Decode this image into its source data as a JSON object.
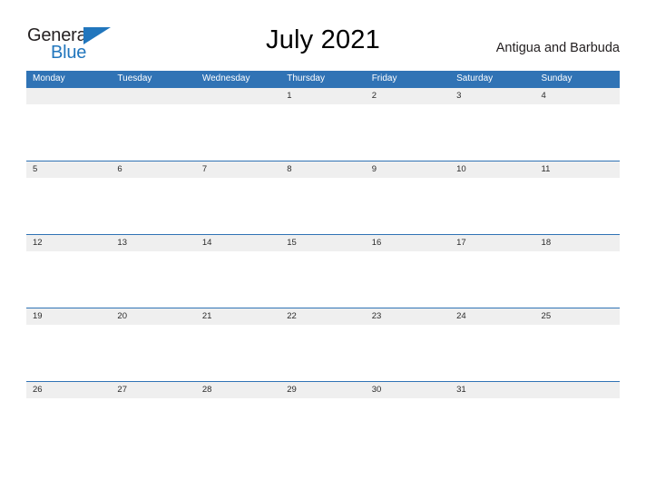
{
  "logo": {
    "word_top": "General",
    "word_bottom": "Blue",
    "triangle_icon": "triangle-icon",
    "brand_color": "#2176bd",
    "text_color": "#231f20"
  },
  "header": {
    "title": "July 2021",
    "subtitle": "Antigua and Barbuda"
  },
  "calendar": {
    "header_background": "#3073b5",
    "band_background": "#efefef",
    "band_border_color": "#3073b5",
    "weekdays": [
      "Monday",
      "Tuesday",
      "Wednesday",
      "Thursday",
      "Friday",
      "Saturday",
      "Sunday"
    ],
    "weeks": [
      [
        "",
        "",
        "",
        "1",
        "2",
        "3",
        "4"
      ],
      [
        "5",
        "6",
        "7",
        "8",
        "9",
        "10",
        "11"
      ],
      [
        "12",
        "13",
        "14",
        "15",
        "16",
        "17",
        "18"
      ],
      [
        "19",
        "20",
        "21",
        "22",
        "23",
        "24",
        "25"
      ],
      [
        "26",
        "27",
        "28",
        "29",
        "30",
        "31",
        ""
      ]
    ]
  }
}
